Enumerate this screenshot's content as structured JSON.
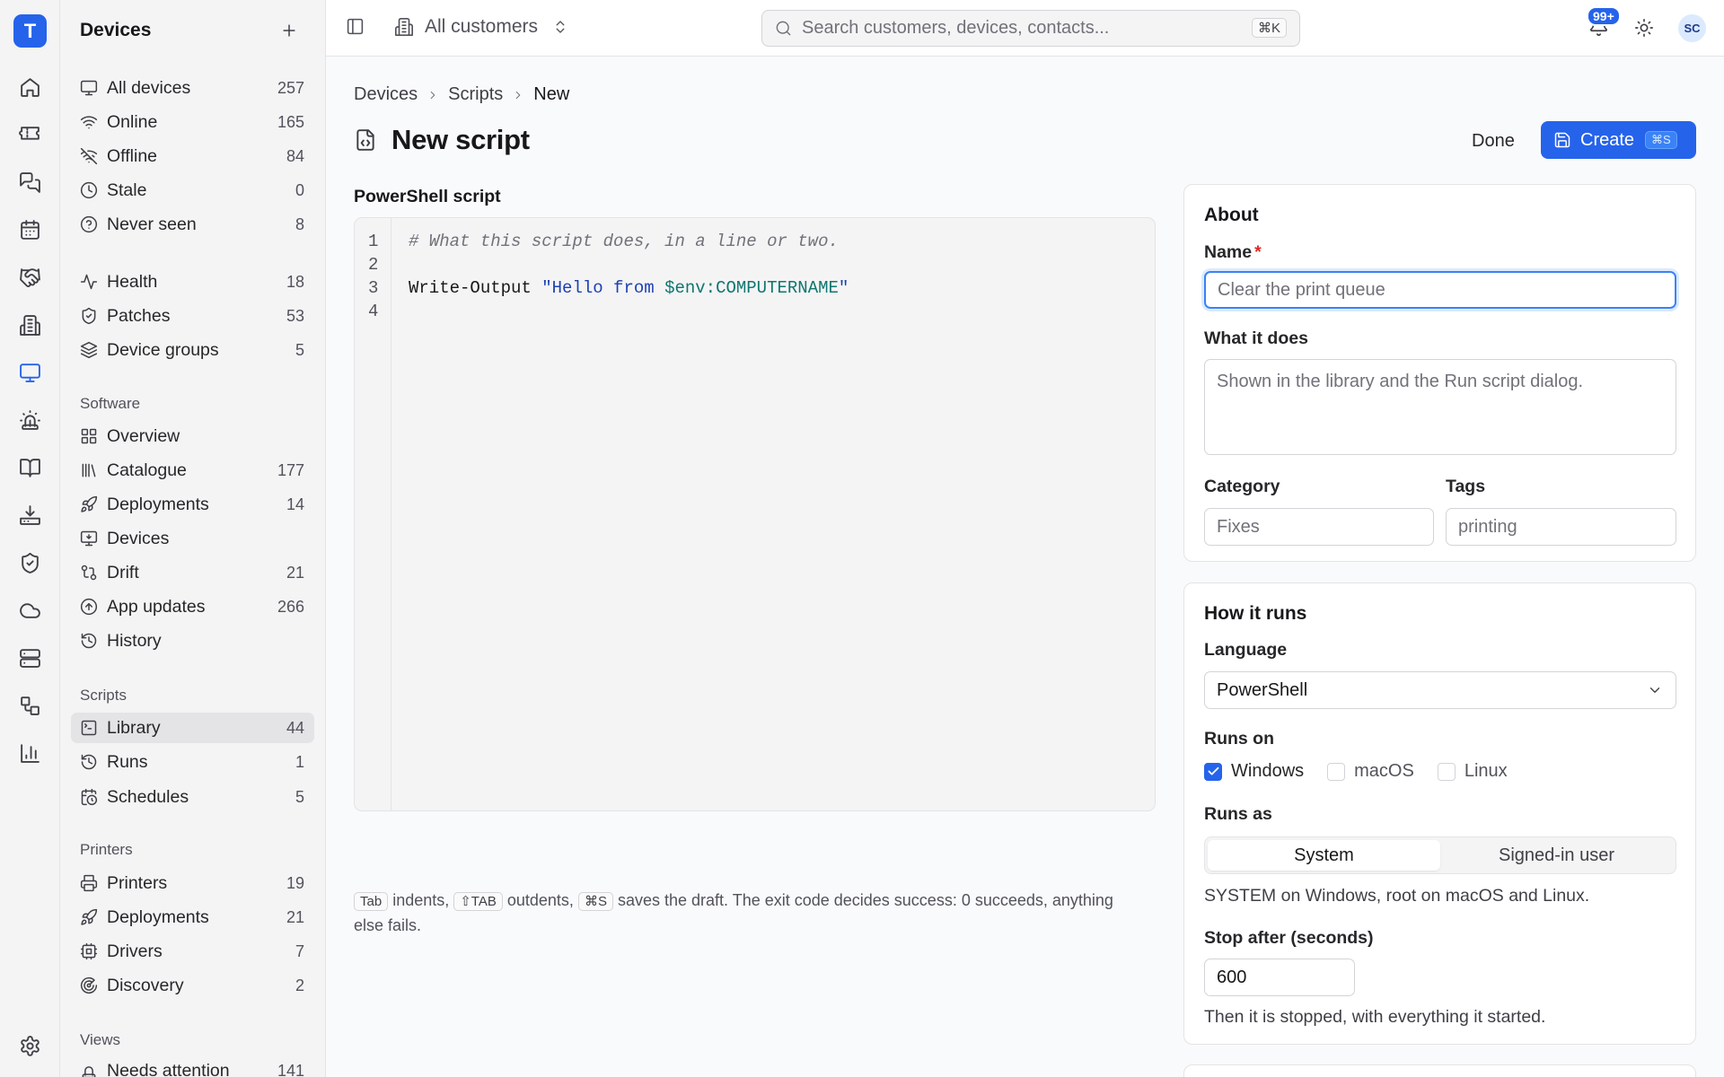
{
  "app": {
    "logo_letter": "T"
  },
  "sidebar": {
    "title": "Devices",
    "groups": [
      {
        "items": [
          {
            "label": "All devices",
            "count": "257",
            "icon": "monitor-icon"
          },
          {
            "label": "Online",
            "count": "165",
            "icon": "wifi-icon"
          },
          {
            "label": "Offline",
            "count": "84",
            "icon": "wifi-off-icon"
          },
          {
            "label": "Stale",
            "count": "0",
            "icon": "clock-icon"
          },
          {
            "label": "Never seen",
            "count": "8",
            "icon": "help-circle-icon"
          }
        ]
      },
      {
        "items": [
          {
            "label": "Health",
            "count": "18",
            "icon": "activity-icon"
          },
          {
            "label": "Patches",
            "count": "53",
            "icon": "shield-check-icon"
          },
          {
            "label": "Device groups",
            "count": "5",
            "icon": "layers-icon"
          }
        ]
      }
    ],
    "software": {
      "title": "Software",
      "items": [
        {
          "label": "Overview",
          "count": "",
          "icon": "grid-icon"
        },
        {
          "label": "Catalogue",
          "count": "177",
          "icon": "library-icon"
        },
        {
          "label": "Deployments",
          "count": "14",
          "icon": "rocket-icon"
        },
        {
          "label": "Devices",
          "count": "",
          "icon": "monitor-download-icon"
        },
        {
          "label": "Drift",
          "count": "21",
          "icon": "git-compare-icon"
        },
        {
          "label": "App updates",
          "count": "266",
          "icon": "arrow-up-circle-icon"
        },
        {
          "label": "History",
          "count": "",
          "icon": "history-icon"
        }
      ]
    },
    "scripts": {
      "title": "Scripts",
      "items": [
        {
          "label": "Library",
          "count": "44",
          "icon": "terminal-square-icon"
        },
        {
          "label": "Runs",
          "count": "1",
          "icon": "history-icon"
        },
        {
          "label": "Schedules",
          "count": "5",
          "icon": "calendar-clock-icon"
        }
      ]
    },
    "printers": {
      "title": "Printers",
      "items": [
        {
          "label": "Printers",
          "count": "19",
          "icon": "printer-icon"
        },
        {
          "label": "Deployments",
          "count": "21",
          "icon": "rocket-icon"
        },
        {
          "label": "Drivers",
          "count": "7",
          "icon": "chip-icon"
        },
        {
          "label": "Discovery",
          "count": "2",
          "icon": "radar-icon"
        }
      ]
    },
    "views": {
      "title": "Views",
      "items": [
        {
          "label": "Needs attention",
          "count": "141",
          "icon": "alert-icon"
        }
      ]
    }
  },
  "topbar": {
    "customers_label": "All customers",
    "search_placeholder": "Search customers, devices, contacts...",
    "search_shortcut": "⌘K",
    "notifications_badge": "99+",
    "avatar_initials": "SC"
  },
  "breadcrumb": {
    "items": [
      "Devices",
      "Scripts"
    ],
    "current": "New"
  },
  "page": {
    "title": "New script",
    "done_label": "Done",
    "create_label": "Create",
    "create_shortcut": "⌘S"
  },
  "editor": {
    "label": "PowerShell script",
    "line_numbers": [
      "1",
      "2",
      "3",
      "4"
    ],
    "line1_comment": "# What this script does, in a line or two.",
    "line3_cmd": "Write-Output ",
    "line3_str_open": "\"Hello from ",
    "line3_var": "$env:COMPUTERNAME",
    "line3_str_close": "\""
  },
  "hint": {
    "key_tab": "Tab",
    "text1": " indents, ",
    "key_shift_tab": "⇧TAB",
    "text2": " outdents, ",
    "key_save": "⌘S",
    "text3": " saves the draft. The exit code decides success: 0 succeeds, anything else fails."
  },
  "about": {
    "title": "About",
    "name_label": "Name",
    "name_required": "*",
    "name_placeholder": "Clear the print queue",
    "what_label": "What it does",
    "what_placeholder": "Shown in the library and the Run script dialog.",
    "category_label": "Category",
    "category_placeholder": "Fixes",
    "tags_label": "Tags",
    "tags_placeholder": "printing"
  },
  "how": {
    "title": "How it runs",
    "language_label": "Language",
    "language_value": "PowerShell",
    "runs_on_label": "Runs on",
    "runs_on": [
      {
        "label": "Windows",
        "checked": true
      },
      {
        "label": "macOS",
        "checked": false
      },
      {
        "label": "Linux",
        "checked": false
      }
    ],
    "runs_as_label": "Runs as",
    "runs_as_options": [
      "System",
      "Signed-in user"
    ],
    "runs_as_selected": 0,
    "runs_as_help": "SYSTEM on Windows, root on macOS and Linux.",
    "stop_label": "Stop after (seconds)",
    "stop_value": "600",
    "stop_help": "Then it is stopped, with everything it started."
  },
  "colors": {
    "accent": "#2563eb",
    "required": "#dc2626"
  }
}
